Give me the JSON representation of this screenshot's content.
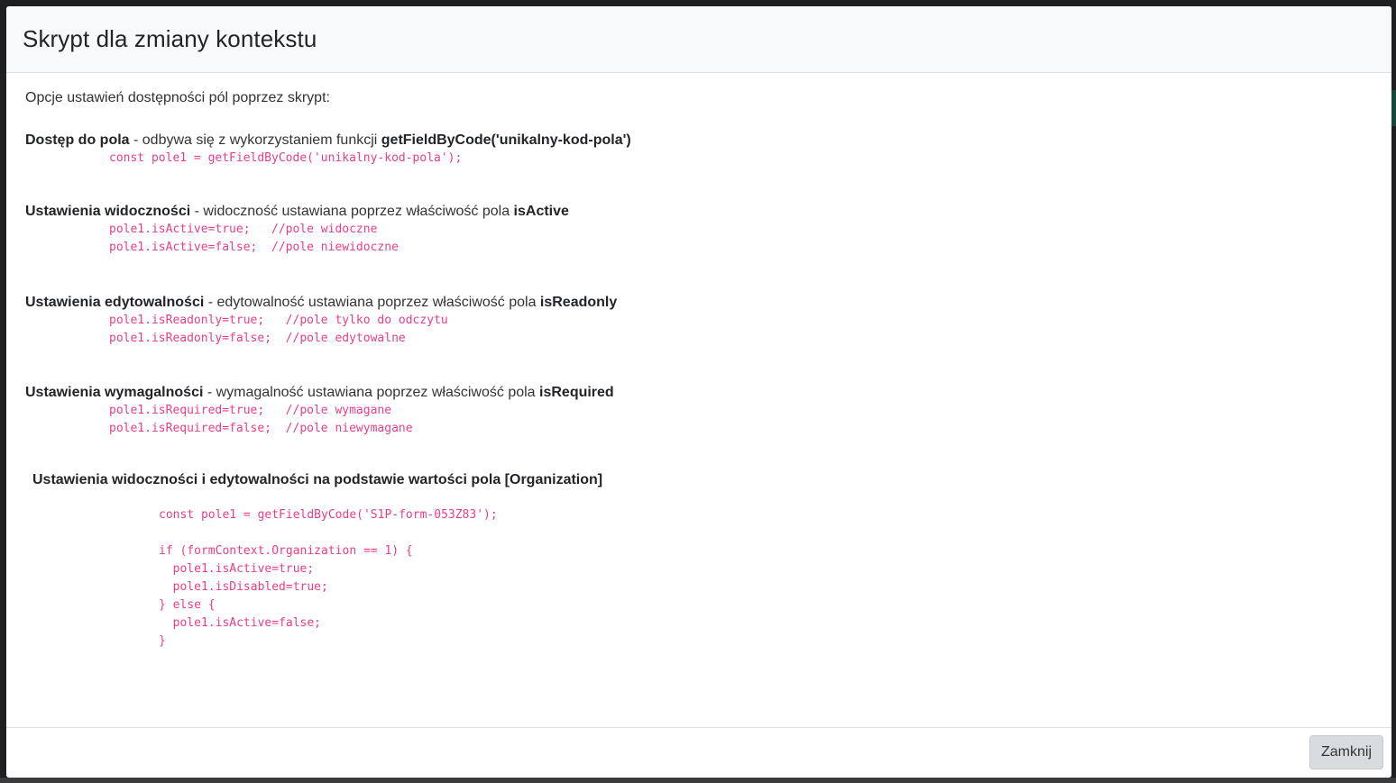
{
  "modal": {
    "title": "Skrypt dla zmiany kontekstu",
    "intro": "Opcje ustawień dostępności pól poprzez skrypt:",
    "close_label": "Zamknij"
  },
  "sections": [
    {
      "heading": "Dostęp do pola",
      "description": " - odbywa się z wykorzystaniem funkcji ",
      "keyword": "getFieldByCode('unikalny-kod-pola')",
      "code": [
        "const pole1 = getFieldByCode('unikalny-kod-pola');"
      ]
    },
    {
      "heading": "Ustawienia widoczności",
      "description": " - widoczność ustawiana poprzez właściwość pola ",
      "keyword": "isActive",
      "code": [
        "pole1.isActive=true;   //pole widoczne",
        "pole1.isActive=false;  //pole niewidoczne"
      ]
    },
    {
      "heading": "Ustawienia edytowalności",
      "description": " - edytowalność ustawiana poprzez właściwość pola ",
      "keyword": "isReadonly",
      "code": [
        "pole1.isReadonly=true;   //pole tylko do odczytu",
        "pole1.isReadonly=false;  //pole edytowalne"
      ]
    },
    {
      "heading": "Ustawienia wymagalności",
      "description": " - wymagalność ustawiana poprzez właściwość pola ",
      "keyword": "isRequired",
      "code": [
        "pole1.isRequired=true;   //pole wymagane",
        "pole1.isRequired=false;  //pole niewymagane"
      ]
    }
  ],
  "example": {
    "title": "Ustawienia widoczności i edytowalności na podstawie wartości pola [Organization]",
    "code": [
      "const pole1 = getFieldByCode('S1P-form-053Z83');",
      "",
      "if (formContext.Organization == 1) {",
      "  pole1.isActive=true;",
      "  pole1.isDisabled=true;",
      "} else {",
      "  pole1.isActive=false;",
      "}"
    ]
  }
}
